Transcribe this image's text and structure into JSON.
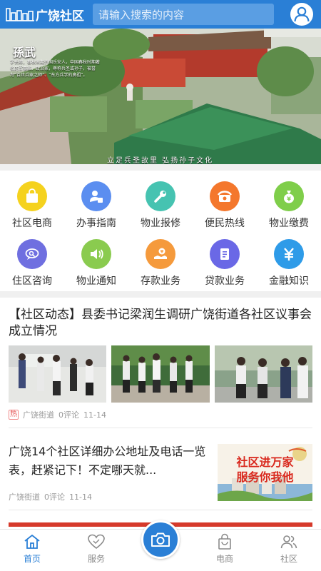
{
  "header": {
    "app_name": "广饶社区",
    "search_placeholder": "请输入搜索的内容"
  },
  "banner": {
    "caption": "孫武",
    "intro": "字长卿，春秋末期齐国乐安人，中国春秋时期著名的军事家、政治家，尊称兵圣或孙子，被誉为“百世兵家之师”、“东方兵学的鼻祖”。",
    "footer": "立足兵圣故里 弘扬孙子文化"
  },
  "grid": {
    "items": [
      {
        "label": "社区电商",
        "icon": "shopping-bag-icon",
        "color": "#f5d21e"
      },
      {
        "label": "办事指南",
        "icon": "user-guide-icon",
        "color": "#5b8ef0"
      },
      {
        "label": "物业报修",
        "icon": "wrench-icon",
        "color": "#46c3b1"
      },
      {
        "label": "便民热线",
        "icon": "phone-icon",
        "color": "#f4772c"
      },
      {
        "label": "物业缴费",
        "icon": "money-bag-icon",
        "color": "#7fce4a"
      },
      {
        "label": "住区咨询",
        "icon": "chat-search-icon",
        "color": "#6f6fe0"
      },
      {
        "label": "物业通知",
        "icon": "speaker-icon",
        "color": "#8acb4f"
      },
      {
        "label": "存款业务",
        "icon": "deposit-icon",
        "color": "#f59a3c"
      },
      {
        "label": "贷款业务",
        "icon": "loan-book-icon",
        "color": "#6a68e6"
      },
      {
        "label": "金融知识",
        "icon": "yuan-icon",
        "color": "#2e9be8"
      }
    ]
  },
  "news": [
    {
      "title": "【社区动态】县委书记梁润生调研广饶街道各社区议事会成立情况",
      "badge": "热",
      "source": "广饶街道",
      "comments": "0评论",
      "date": "11-14"
    },
    {
      "title": "广饶14个社区详细办公地址及电话一览表，赶紧记下！不定哪天就...",
      "source": "广饶街道",
      "comments": "0评论",
      "date": "11-14",
      "image_line1": "社区进万家",
      "image_line2": "服务你我他"
    }
  ],
  "tabbar": {
    "items": [
      {
        "label": "首页",
        "icon": "home-icon",
        "active": true
      },
      {
        "label": "服务",
        "icon": "heart-icon",
        "active": false
      },
      {
        "label": "电商",
        "icon": "shopping-bag-icon",
        "active": false
      },
      {
        "label": "社区",
        "icon": "people-icon",
        "active": false
      }
    ]
  },
  "colors": {
    "primary": "#2a7fd6",
    "hot": "#e65555"
  }
}
